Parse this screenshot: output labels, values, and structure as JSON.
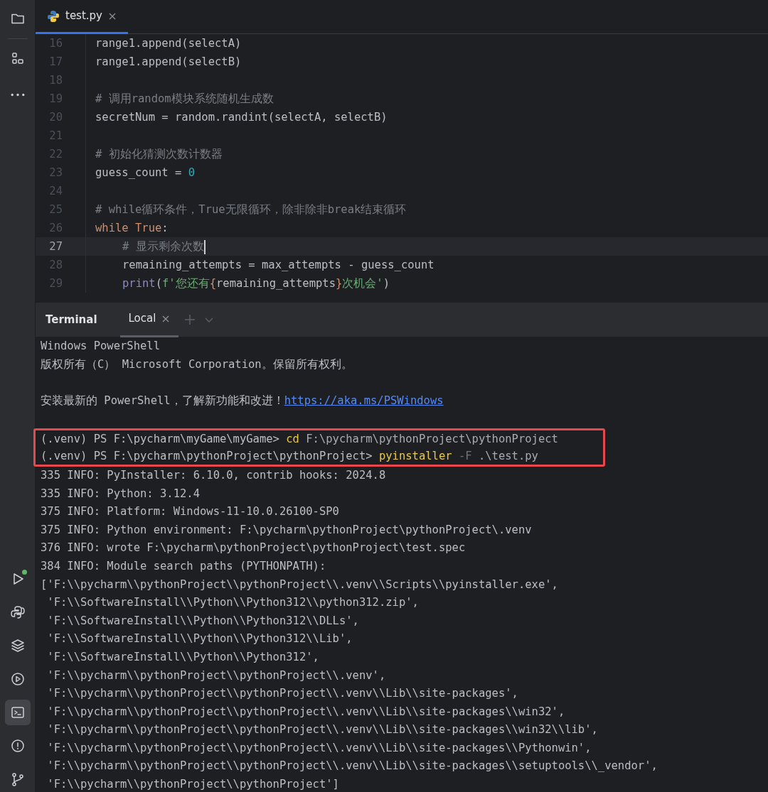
{
  "toolstrip": {
    "top_items": [
      {
        "kind": "folder",
        "selected": false
      },
      {
        "kind": "structure",
        "selected": false
      },
      {
        "kind": "more",
        "selected": false
      }
    ],
    "bottom_items": [
      {
        "kind": "run",
        "selected": false,
        "notification": true
      },
      {
        "kind": "python",
        "selected": false,
        "notification": false
      },
      {
        "kind": "layers",
        "selected": false,
        "notification": false
      },
      {
        "kind": "services",
        "selected": false,
        "notification": false
      },
      {
        "kind": "terminal",
        "selected": true,
        "notification": false
      },
      {
        "kind": "problems",
        "selected": false,
        "notification": false
      },
      {
        "kind": "git",
        "selected": false,
        "notification": false
      }
    ]
  },
  "editor": {
    "tabs": [
      {
        "label": "test.py",
        "selected": true
      }
    ],
    "lines": [
      {
        "number": "16",
        "current": false,
        "tokens": [
          {
            "kind": "plain",
            "text": "range1.append(selectA)"
          }
        ]
      },
      {
        "number": "17",
        "current": false,
        "tokens": [
          {
            "kind": "plain",
            "text": "range1.append(selectB)"
          }
        ]
      },
      {
        "number": "18",
        "current": false
      },
      {
        "number": "19",
        "current": false,
        "tokens": [
          {
            "kind": "comment",
            "text": "# 调用random模块系统随机生成数"
          }
        ]
      },
      {
        "number": "20",
        "current": false,
        "tokens": [
          {
            "kind": "plain",
            "text": "secretNum = random.randint(selectA, selectB)"
          }
        ]
      },
      {
        "number": "21",
        "current": false
      },
      {
        "number": "22",
        "current": false,
        "tokens": [
          {
            "kind": "comment",
            "text": "# 初始化猜测次数计数器"
          }
        ]
      },
      {
        "number": "23",
        "current": false,
        "tokens": [
          {
            "kind": "plain",
            "text": "guess_count = "
          },
          {
            "kind": "number",
            "text": "0"
          }
        ]
      },
      {
        "number": "24",
        "current": false
      },
      {
        "number": "25",
        "current": false,
        "tokens": [
          {
            "kind": "comment",
            "text": "# while循环条件，True无限循环，除非除非break结束循环"
          }
        ]
      },
      {
        "number": "26",
        "current": false,
        "tokens": [
          {
            "kind": "keyword",
            "text": "while True"
          },
          {
            "kind": "plain",
            "text": ":"
          }
        ],
        "children": [
          {
            "number": "27",
            "current": true,
            "tokens": [
              {
                "kind": "comment",
                "text": "# 显示剩余次数"
              }
            ]
          },
          {
            "number": "28",
            "current": false,
            "tokens": [
              {
                "kind": "plain",
                "text": "remaining_attempts = max_attempts - guess_count"
              }
            ]
          },
          {
            "number": "29",
            "current": false,
            "tokens": [
              {
                "kind": "builtin",
                "text": "print"
              },
              {
                "kind": "plain",
                "text": "("
              },
              {
                "kind": "string",
                "text": "f'您还有"
              },
              {
                "kind": "brace",
                "text": "{"
              },
              {
                "kind": "plain",
                "text": "remaining_attempts"
              },
              {
                "kind": "brace",
                "text": "}"
              },
              {
                "kind": "string",
                "text": "次机会'"
              },
              {
                "kind": "plain",
                "text": ")"
              }
            ]
          }
        ]
      }
    ]
  },
  "terminal": {
    "title": "Terminal",
    "tabs": [
      {
        "label": "Local",
        "selected": true
      }
    ],
    "lines": [
      {
        "kind": "text",
        "text": "Windows PowerShell"
      },
      {
        "kind": "text",
        "text": "版权所有（C） Microsoft Corporation。保留所有权利。"
      },
      {
        "kind": "blank"
      },
      {
        "kind": "link_line",
        "text": "安装最新的 PowerShell，了解新功能和改进！",
        "link": "https://aka.ms/PSWindows"
      },
      {
        "kind": "blank"
      },
      {
        "kind": "highlight_box",
        "lines": [
          {
            "kind": "command",
            "segments": [
              {
                "kind": "prompt",
                "text": "(.venv) PS F:\\pycharm\\myGame\\myGame> "
              },
              {
                "kind": "command",
                "text": "cd"
              },
              {
                "kind": "arg",
                "text": " F:\\pycharm\\pythonProject\\pythonProject"
              }
            ]
          },
          {
            "kind": "command",
            "segments": [
              {
                "kind": "prompt",
                "text": "(.venv) PS F:\\pycharm\\pythonProject\\pythonProject> "
              },
              {
                "kind": "command",
                "text": "pyinstaller"
              },
              {
                "kind": "flag",
                "text": " -F"
              },
              {
                "kind": "arg",
                "text": " .\\test.py"
              }
            ]
          }
        ]
      },
      {
        "kind": "text",
        "text": "335 INFO: PyInstaller: 6.10.0, contrib hooks: 2024.8"
      },
      {
        "kind": "text",
        "text": "335 INFO: Python: 3.12.4"
      },
      {
        "kind": "text",
        "text": "375 INFO: Platform: Windows-11-10.0.26100-SP0"
      },
      {
        "kind": "text",
        "text": "375 INFO: Python environment: F:\\pycharm\\pythonProject\\pythonProject\\.venv"
      },
      {
        "kind": "text",
        "text": "376 INFO: wrote F:\\pycharm\\pythonProject\\pythonProject\\test.spec"
      },
      {
        "kind": "text",
        "text": "384 INFO: Module search paths (PYTHONPATH):"
      },
      {
        "kind": "text",
        "text": "['F:\\\\pycharm\\\\pythonProject\\\\pythonProject\\\\.venv\\\\Scripts\\\\pyinstaller.exe',"
      },
      {
        "kind": "text",
        "text": " 'F:\\\\SoftwareInstall\\\\Python\\\\Python312\\\\python312.zip',"
      },
      {
        "kind": "text",
        "text": " 'F:\\\\SoftwareInstall\\\\Python\\\\Python312\\\\DLLs',"
      },
      {
        "kind": "text",
        "text": " 'F:\\\\SoftwareInstall\\\\Python\\\\Python312\\\\Lib',"
      },
      {
        "kind": "text",
        "text": " 'F:\\\\SoftwareInstall\\\\Python\\\\Python312',"
      },
      {
        "kind": "text",
        "text": " 'F:\\\\pycharm\\\\pythonProject\\\\pythonProject\\\\.venv',"
      },
      {
        "kind": "text",
        "text": " 'F:\\\\pycharm\\\\pythonProject\\\\pythonProject\\\\.venv\\\\Lib\\\\site-packages',"
      },
      {
        "kind": "text",
        "text": " 'F:\\\\pycharm\\\\pythonProject\\\\pythonProject\\\\.venv\\\\Lib\\\\site-packages\\\\win32',"
      },
      {
        "kind": "text",
        "text": " 'F:\\\\pycharm\\\\pythonProject\\\\pythonProject\\\\.venv\\\\Lib\\\\site-packages\\\\win32\\\\lib',"
      },
      {
        "kind": "text",
        "text": " 'F:\\\\pycharm\\\\pythonProject\\\\pythonProject\\\\.venv\\\\Lib\\\\site-packages\\\\Pythonwin',"
      },
      {
        "kind": "text",
        "text": " 'F:\\\\pycharm\\\\pythonProject\\\\pythonProject\\\\.venv\\\\Lib\\\\site-packages\\\\setuptools\\\\_vendor',"
      },
      {
        "kind": "text",
        "text": " 'F:\\\\pycharm\\\\pythonProject\\\\pythonProject']"
      }
    ]
  }
}
